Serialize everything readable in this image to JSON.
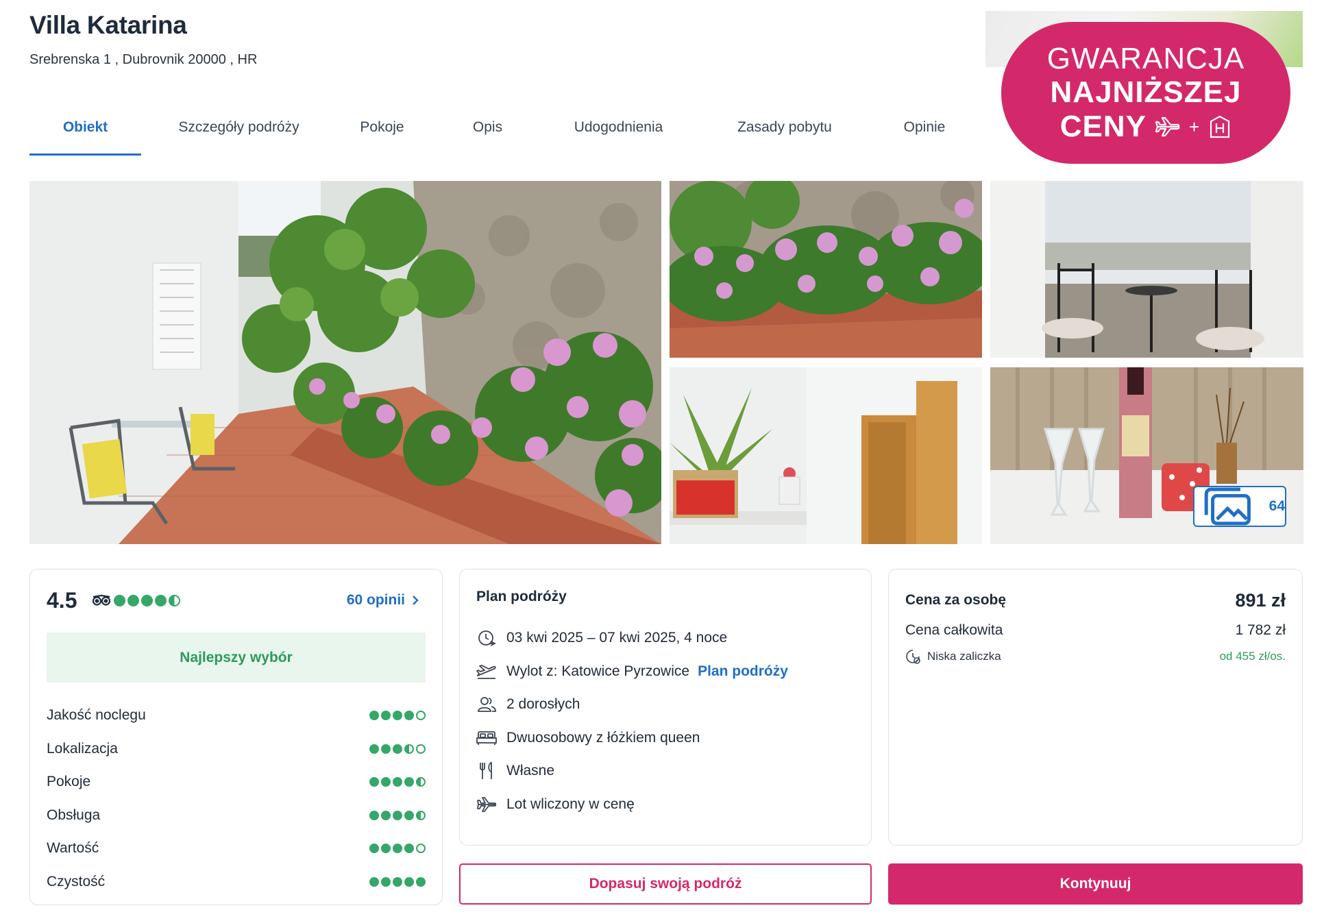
{
  "hotel": {
    "name": "Villa Katarina",
    "address": "Srebrenska 1 , Dubrovnik 20000 , HR"
  },
  "tabs": [
    {
      "label": "Obiekt",
      "active": true
    },
    {
      "label": "Szczegóły podróży"
    },
    {
      "label": "Pokoje"
    },
    {
      "label": "Opis"
    },
    {
      "label": "Udogodnienia"
    },
    {
      "label": "Zasady pobytu"
    },
    {
      "label": "Opinie"
    }
  ],
  "badge": {
    "line1": "GWARANCJA",
    "line2": "NAJNIŻSZEJ",
    "line3": "CENY",
    "icons": [
      "plane-icon",
      "plus",
      "hotel-h-icon"
    ],
    "color": "#d3296a"
  },
  "gallery": {
    "photo_count": "64",
    "photos": [
      "garden-terrace",
      "hydrangea-flowers",
      "balcony-chairs",
      "interior-hallway",
      "wine-table"
    ]
  },
  "rating": {
    "score": "4.5",
    "tripadvisor_rating": 4.5,
    "reviews_link": "60 opinii",
    "best_choice": "Najlepszy wybór",
    "categories": [
      {
        "label": "Jakość noclegu",
        "value": 4
      },
      {
        "label": "Lokalizacja",
        "value": 3.5
      },
      {
        "label": "Pokoje",
        "value": 4.5
      },
      {
        "label": "Obsługa",
        "value": 4.5
      },
      {
        "label": "Wartość",
        "value": 4
      },
      {
        "label": "Czystość",
        "value": 5
      }
    ]
  },
  "plan": {
    "title": "Plan podróży",
    "rows": [
      {
        "icon": "calendar-plane-icon",
        "text": "03 kwi 2025 – 07 kwi 2025, 4 noce"
      },
      {
        "icon": "departure-icon",
        "text": "Wylot z: Katowice Pyrzowice",
        "link": "Plan podróży"
      },
      {
        "icon": "people-icon",
        "text": "2 dorosłych"
      },
      {
        "icon": "bed-icon",
        "text": "Dwuosobowy z łóżkiem queen"
      },
      {
        "icon": "cutlery-icon",
        "text": "Własne"
      },
      {
        "icon": "plane-icon",
        "text": "Lot wliczony w cenę"
      }
    ]
  },
  "price": {
    "per_person_label": "Cena za osobę",
    "per_person_value": "891 zł",
    "total_label": "Cena całkowita",
    "total_value": "1 782 zł",
    "deposit_label": "Niska zaliczka",
    "deposit_value": "od 455 zł/os."
  },
  "buttons": {
    "customize": "Dopasuj swoją podróż",
    "continue": "Kontynuuj"
  },
  "colors": {
    "accent": "#1f6fc5",
    "brand": "#d3296a",
    "green": "#34a769"
  }
}
